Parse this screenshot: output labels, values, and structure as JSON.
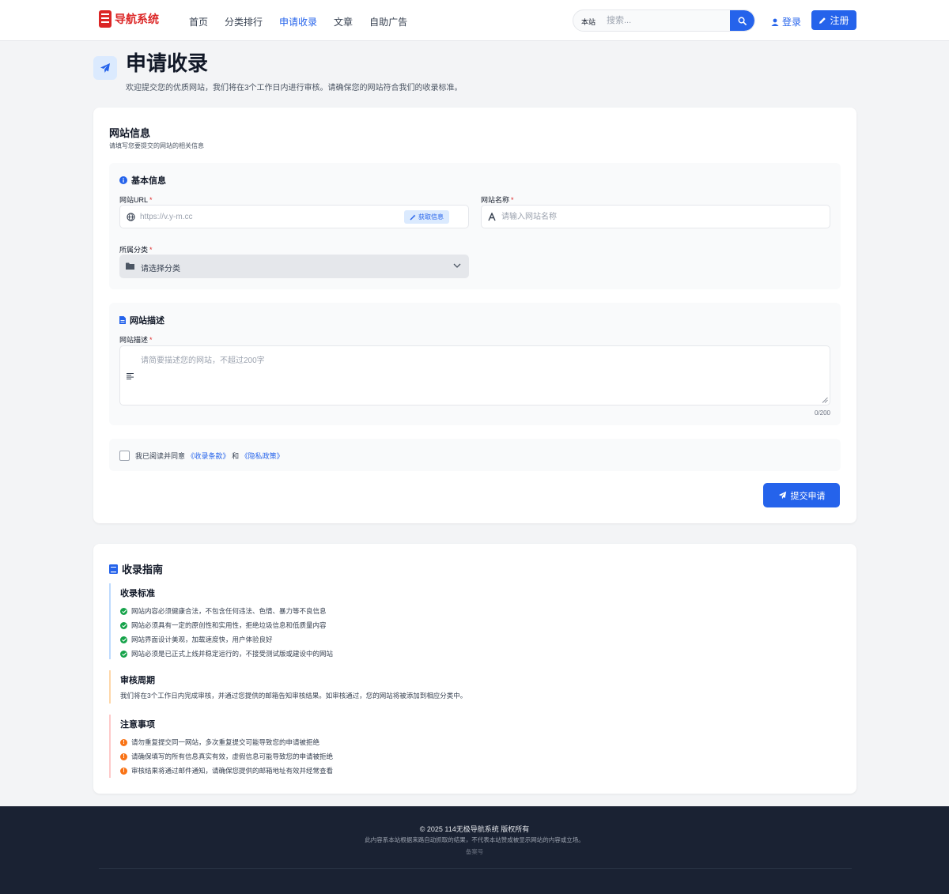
{
  "header": {
    "logo_text": "导航系统",
    "nav": [
      "首页",
      "分类排行",
      "申请收录",
      "文章",
      "自助广告"
    ],
    "active_nav": "申请收录",
    "search_scope": "本站",
    "search_placeholder": "搜索...",
    "login_label": "登录",
    "register_label": "注册",
    "accent_color": "#2563eb",
    "brand_color": "#dc2626"
  },
  "page": {
    "title": "申请收录",
    "subtitle": "欢迎提交您的优质网站，我们将在3个工作日内进行审核。请确保您的网站符合我们的收录标准。"
  },
  "form": {
    "title": "网站信息",
    "subtitle": "请填写您要提交的网站的相关信息",
    "basic_section": "基本信息",
    "url_label": "网站URL",
    "url_placeholder": "https://v.y-m.cc",
    "fetch_label": "获取信息",
    "name_label": "网站名称",
    "name_placeholder": "请输入网站名称",
    "category_label": "所属分类",
    "category_value": "请选择分类",
    "desc_section": "网站描述",
    "desc_label": "网站描述",
    "desc_placeholder": "请简要描述您的网站，不超过200字",
    "desc_counter": "0/200",
    "required_mark": "*",
    "agree_prefix": "我已阅读并同意",
    "agree_terms": "《收录条款》",
    "agree_and": "和",
    "agree_privacy": "《隐私政策》",
    "submit_label": "提交申请"
  },
  "guide": {
    "title": "收录指南",
    "standard_title": "收录标准",
    "standards": [
      "网站内容必须健康合法，不包含任何违法、色情、暴力等不良信息",
      "网站必须具有一定的原创性和实用性，拒绝垃圾信息和低质量内容",
      "网站界面设计美观，加载速度快，用户体验良好",
      "网站必须是已正式上线并稳定运行的，不接受测试版或建设中的网站"
    ],
    "cycle_title": "审核周期",
    "cycle_text": "我们将在3个工作日内完成审核，并通过您提供的邮箱告知审核结果。如审核通过，您的网站将被添加到相应分类中。",
    "notes_title": "注意事项",
    "notes": [
      "请勿重复提交同一网站，多次重复提交可能导致您的申请被拒绝",
      "请确保填写的所有信息真实有效，虚假信息可能导致您的申请被拒绝",
      "审核结果将通过邮件通知，请确保您提供的邮箱地址有效并经常查看"
    ]
  },
  "footer": {
    "copyright": "© 2025 114无极导航系统 版权所有",
    "disclaimer": "此内容系本站根据来路自动抓取的结果，不代表本站赞成被显示网站的内容或立场。",
    "icp": "备案号"
  }
}
